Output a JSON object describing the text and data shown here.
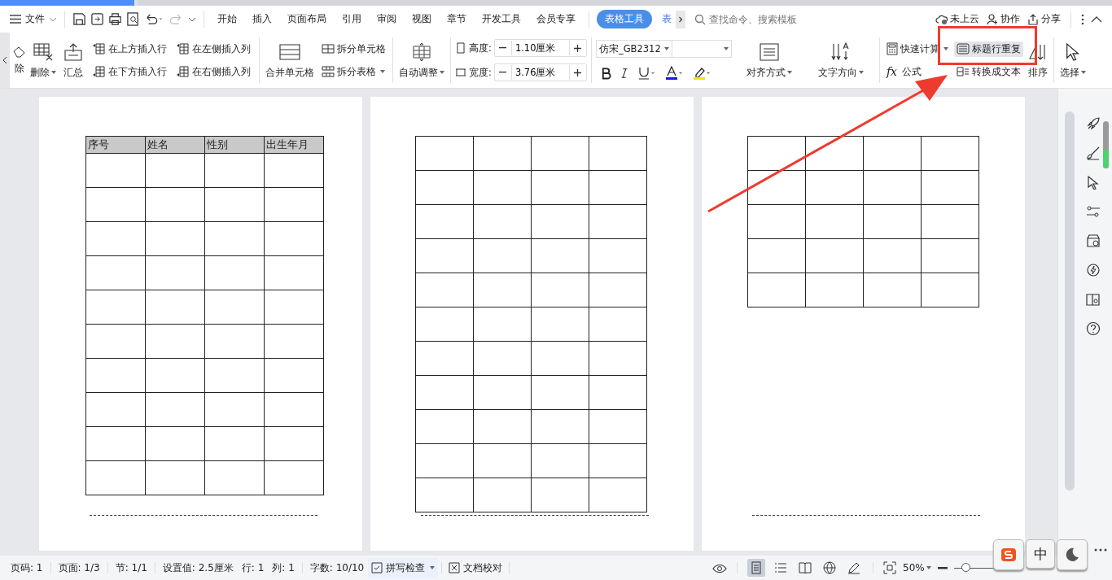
{
  "menu_bar": {
    "file": "文件",
    "tabs": [
      {
        "label": "开始",
        "selected": false
      },
      {
        "label": "插入",
        "selected": false
      },
      {
        "label": "页面布局",
        "selected": false
      },
      {
        "label": "引用",
        "selected": false
      },
      {
        "label": "审阅",
        "selected": false
      },
      {
        "label": "视图",
        "selected": false
      },
      {
        "label": "章节",
        "selected": false
      },
      {
        "label": "开发工具",
        "selected": false
      },
      {
        "label": "会员专享",
        "selected": false
      },
      {
        "label": "表格工具",
        "selected": true
      },
      {
        "label": "表",
        "selected": false
      }
    ],
    "search": {
      "placeholder": "查找命令、搜索模板"
    },
    "actions": [
      "未上云",
      "协作",
      "分享"
    ]
  },
  "ribbon": {
    "delete_partial": "除",
    "delete": "删除",
    "summary": "汇总",
    "insert": [
      "在上方插入行",
      "在下方插入行",
      "在左侧插入列",
      "在右侧插入列"
    ],
    "merge": "合并单元格",
    "split_cell": "拆分单元格",
    "split_table": "拆分表格",
    "autofit": "自动调整",
    "height": {
      "label": "高度:",
      "value": "1.10厘米"
    },
    "width": {
      "label": "宽度:",
      "value": "3.76厘米"
    },
    "font": {
      "name": "仿宋_GB2312"
    },
    "align": "对齐方式",
    "direction": "文字方向",
    "quick_calc": "快速计算",
    "formula_icon": "fx",
    "formula": "公式",
    "repeat_header": {
      "label": "标题行重复",
      "selected": true
    },
    "convert": "转换成文本",
    "sort": "排序",
    "select": "选择"
  },
  "document": {
    "table_header": [
      "序号",
      "姓名",
      "性别",
      "出生年月"
    ]
  },
  "status_bar": {
    "items": [
      "页码: 1",
      "页面: 1/3",
      "节: 1/1",
      "设置值: 2.5厘米",
      "行: 1",
      "列: 1",
      "字数: 10/10"
    ],
    "spell_check": "拼写检查",
    "proofread": "文档校对",
    "view_modes": [
      {
        "selected": true
      },
      {
        "selected": false
      },
      {
        "selected": false
      },
      {
        "selected": false
      },
      {
        "selected": false
      }
    ],
    "zoom": "50%",
    "zoom_slider": {
      "level": 0.3
    }
  },
  "ime": {
    "mode": "中"
  }
}
